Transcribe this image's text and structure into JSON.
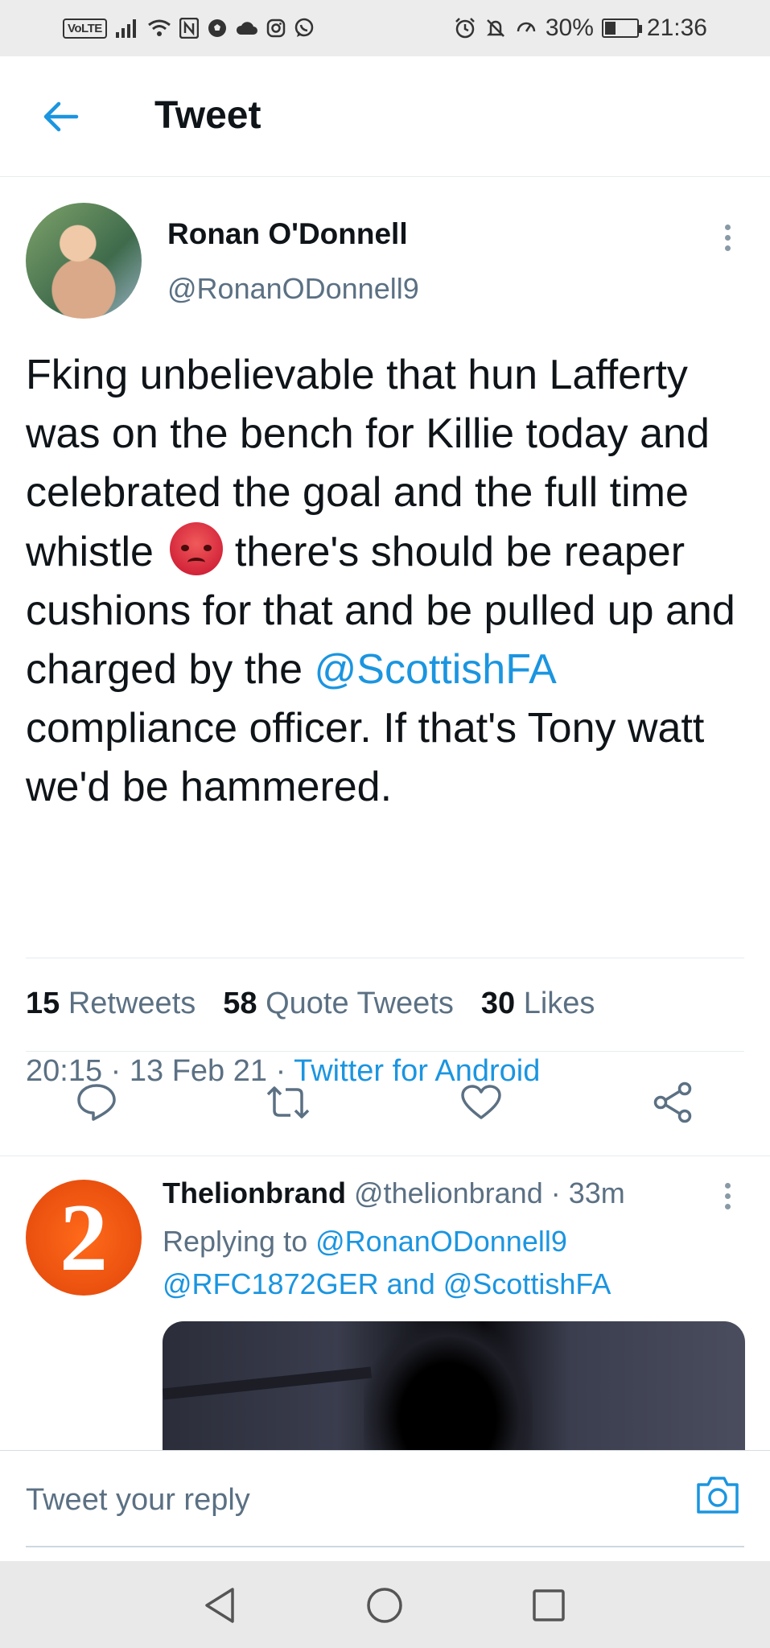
{
  "status_bar": {
    "volte": "VoLTE",
    "battery": "30%",
    "time": "21:36"
  },
  "header": {
    "title": "Tweet"
  },
  "tweet": {
    "author_name": "Ronan O'Donnell",
    "author_handle": "@RonanODonnell9",
    "text_part1": "Fking unbelievable that hun Lafferty was on the bench for Killie today and celebrated the goal and the full time whistle",
    "text_part2": " there's should be reaper cushions for that and be pulled up and charged by the ",
    "mention": "@ScottishFA",
    "text_part3": " compliance officer. If that's Tony watt we'd be hammered.",
    "time": "20:15",
    "date": "13 Feb 21",
    "source": "Twitter for Android",
    "stats": {
      "retweets_count": "15",
      "retweets_label": "Retweets",
      "quotes_count": "58",
      "quotes_label": "Quote Tweets",
      "likes_count": "30",
      "likes_label": "Likes"
    }
  },
  "reply": {
    "name": "Thelionbrand",
    "handle": "@thelionbrand",
    "time": "33m",
    "replying_label": "Replying to",
    "replying_to_1": "@RonanODonnell9",
    "replying_to_2": "@RFC1872GER",
    "and_label": "and",
    "replying_to_3": "@ScottishFA",
    "avatar_text": "2"
  },
  "composer": {
    "placeholder": "Tweet your reply"
  },
  "colors": {
    "accent": "#1b95e0",
    "secondary_text": "#5b7083",
    "primary_text": "#0f1419"
  }
}
